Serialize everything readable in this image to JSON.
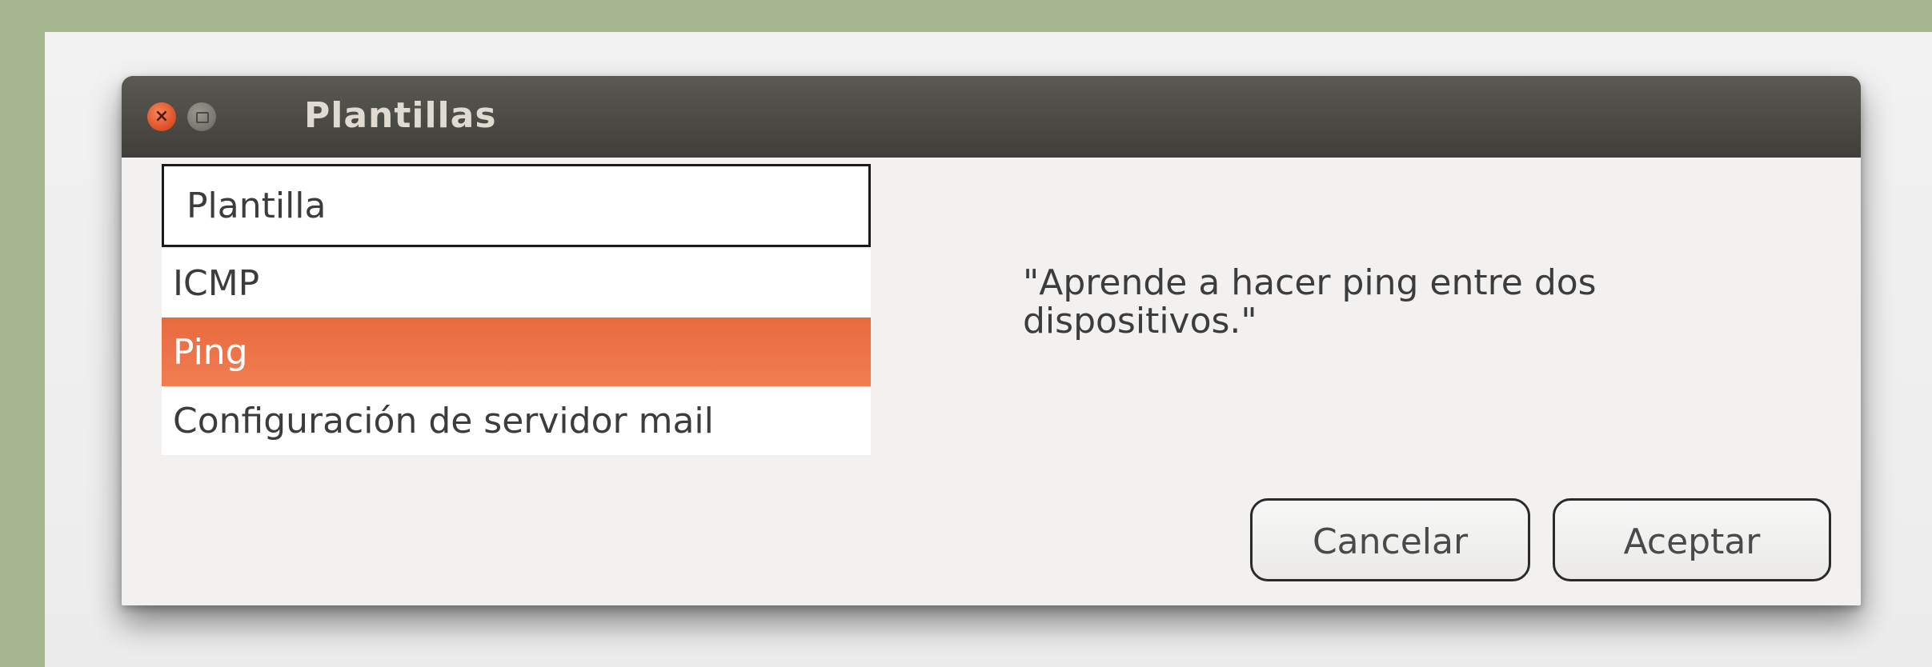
{
  "window": {
    "title": "Plantillas"
  },
  "controls": {
    "close_glyph": "×"
  },
  "list": {
    "header": "Plantilla",
    "items": [
      {
        "label": "ICMP",
        "selected": false
      },
      {
        "label": "Ping",
        "selected": true
      },
      {
        "label": "Configuración de servidor mail",
        "selected": false
      }
    ]
  },
  "description": {
    "line1": "\"Aprende a hacer ping entre dos",
    "line2": "dispositivos.\""
  },
  "buttons": {
    "cancel": "Cancelar",
    "accept": "Aceptar"
  },
  "colors": {
    "desktop": "#a6b790",
    "titlebar": "#4c4b46",
    "selection": "#ec7346",
    "close": "#e1552a"
  }
}
